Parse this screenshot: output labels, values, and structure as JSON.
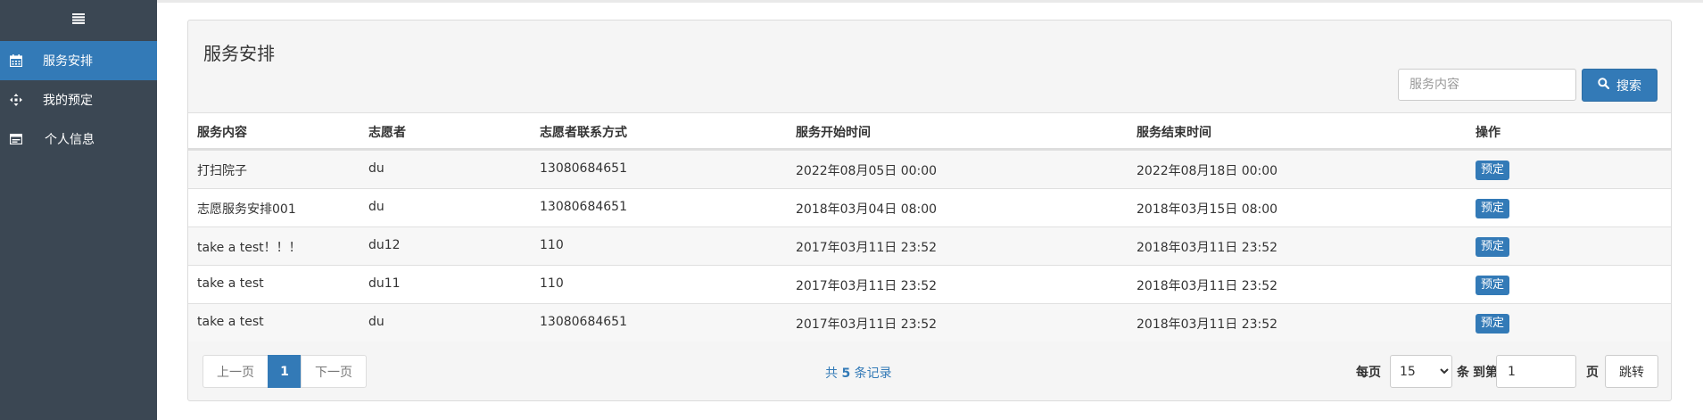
{
  "sidebar": {
    "toggle_icon": "menu-icon",
    "items": [
      {
        "label": "服务安排",
        "icon": "calendar-icon",
        "active": true
      },
      {
        "label": "我的预定",
        "icon": "diamond-arrows-icon",
        "active": false
      },
      {
        "label": "个人信息",
        "icon": "id-card-icon",
        "active": false
      }
    ]
  },
  "panel": {
    "title": "服务安排",
    "search": {
      "placeholder": "服务内容",
      "value": "",
      "button_label": "搜索",
      "icon": "search-icon"
    }
  },
  "table": {
    "columns": [
      "服务内容",
      "志愿者",
      "志愿者联系方式",
      "服务开始时间",
      "服务结束时间",
      "操作"
    ],
    "rows": [
      {
        "content": "打扫院子",
        "volunteer": "du",
        "contact": "13080684651",
        "start": "2022年08月05日 00:00",
        "end": "2022年08月18日 00:00",
        "action": "预定"
      },
      {
        "content": "志愿服务安排001",
        "volunteer": "du",
        "contact": "13080684651",
        "start": "2018年03月04日 08:00",
        "end": "2018年03月15日 08:00",
        "action": "预定"
      },
      {
        "content": "take a test！！！",
        "volunteer": "du12",
        "contact": "110",
        "start": "2017年03月11日 23:52",
        "end": "2018年03月11日 23:52",
        "action": "预定"
      },
      {
        "content": "take a test",
        "volunteer": "du11",
        "contact": "110",
        "start": "2017年03月11日 23:52",
        "end": "2018年03月11日 23:52",
        "action": "预定"
      },
      {
        "content": "take a test",
        "volunteer": "du",
        "contact": "13080684651",
        "start": "2017年03月11日 23:52",
        "end": "2018年03月11日 23:52",
        "action": "预定"
      }
    ]
  },
  "pagination": {
    "prev_label": "上一页",
    "current_page": "1",
    "next_label": "下一页",
    "total_prefix": "共",
    "total_count": "5",
    "total_suffix": "条记录",
    "per_page_label": "每页",
    "per_page_value": "15",
    "per_page_unit": "条",
    "goto_label": "到第",
    "goto_value": "1",
    "page_unit": "页",
    "jump_label": "跳转"
  },
  "colors": {
    "sidebar_bg": "#3b4753",
    "accent": "#337ab7",
    "panel_bg": "#f5f5f5"
  }
}
